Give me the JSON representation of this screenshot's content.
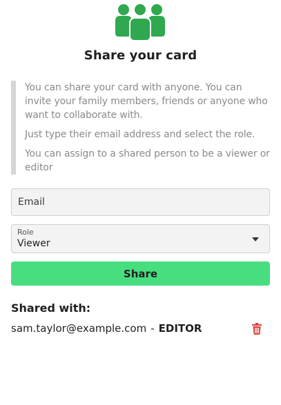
{
  "header": {
    "icon": "group-of-people-icon",
    "icon_color": "#2fa84f",
    "title": "Share your card"
  },
  "info": {
    "paragraphs": [
      "You can share your card with anyone. You can invite your family members, friends or anyone who want to collaborate with.",
      "Just type their email address and select the role.",
      "You can assign to a shared person to be a viewer or editor"
    ]
  },
  "form": {
    "email": {
      "placeholder": "Email",
      "value": ""
    },
    "role": {
      "label": "Role",
      "value": "Viewer",
      "icon": "caret-down-icon"
    },
    "share_label": "Share"
  },
  "shared": {
    "heading": "Shared with:",
    "entries": [
      {
        "email": "sam.taylor@example.com",
        "separator": "-",
        "role": "EDITOR",
        "delete_icon": "trash-icon"
      }
    ]
  },
  "colors": {
    "accent": "#48de80",
    "icon_green": "#2fa84f",
    "delete_red": "#e03a3a",
    "info_bar": "#d6d6d6",
    "info_text": "#8a8a8a"
  }
}
